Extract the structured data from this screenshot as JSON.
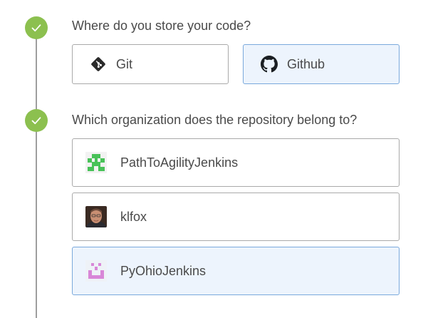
{
  "steps": [
    {
      "question": "Where do you store your code?",
      "options": [
        {
          "label": "Git",
          "icon": "git-icon",
          "selected": false
        },
        {
          "label": "Github",
          "icon": "github-icon",
          "selected": true
        }
      ]
    },
    {
      "question": "Which organization does the repository belong to?",
      "options": [
        {
          "label": "PathToAgilityJenkins",
          "icon": "identicon-green",
          "selected": false
        },
        {
          "label": "klfox",
          "icon": "user-photo-avatar",
          "selected": false
        },
        {
          "label": "PyOhioJenkins",
          "icon": "identicon-pink",
          "selected": true
        }
      ]
    }
  ],
  "colors": {
    "step_complete": "#8cc04f",
    "timeline": "#9e9e9e",
    "option_border": "#a9a9a9",
    "selected_bg": "#edf4fd",
    "selected_border": "#7aa9dc",
    "identicon_green": "#48c258",
    "identicon_pink": "#d887d8"
  }
}
